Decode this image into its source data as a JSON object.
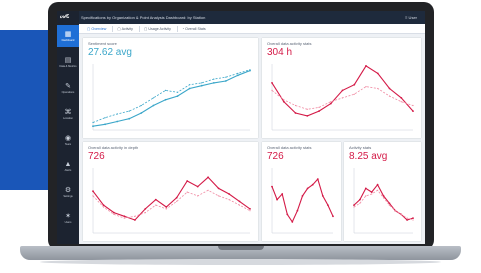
{
  "colors": {
    "accent": "#1f6fd6",
    "teal": "#3aa6c9",
    "crimson": "#d41a47",
    "pink_dashed": "#f08aa2",
    "sidebar": "#1c2330",
    "header": "#1e2a3c",
    "band": "#1a56b8"
  },
  "app": {
    "logo": "ᔕ∕∕Ɛ",
    "header_title": "Specifications by Organization & Point Analysis Dashboard: by Station",
    "header_user": "≡ User"
  },
  "sidebar": {
    "items": [
      {
        "label": "Dashboard",
        "icon": "dashboard-icon",
        "glyph": "▦",
        "active": true
      },
      {
        "label": "Data & Metrics",
        "icon": "data-icon",
        "glyph": "▤",
        "active": false
      },
      {
        "label": "Operations",
        "icon": "wrench-icon",
        "glyph": "✎",
        "active": false
      },
      {
        "label": "Location",
        "icon": "network-icon",
        "glyph": "⌘",
        "active": false
      },
      {
        "label": "Team",
        "icon": "globe-icon",
        "glyph": "◉",
        "active": false
      },
      {
        "label": "Alerts",
        "icon": "warning-icon",
        "glyph": "▲",
        "active": false
      },
      {
        "label": "Settings",
        "icon": "settings-icon",
        "glyph": "⚙",
        "active": false
      },
      {
        "label": "Users",
        "icon": "user-icon",
        "glyph": "✶",
        "active": false
      }
    ]
  },
  "tabs": [
    {
      "label": "▢ Overview",
      "active": true
    },
    {
      "label": "▢ Activity",
      "active": false
    },
    {
      "label": "▢ Usage Activity",
      "active": false
    },
    {
      "label": "◔ Overall Stats",
      "active": false
    }
  ],
  "cards": {
    "c1": {
      "title": "Sentiment score",
      "value": "27.62 avg"
    },
    "c2": {
      "title": "Overall data activity stats",
      "value": "304 h"
    },
    "c3": {
      "title": "Overall data activity in depth",
      "value": "726"
    },
    "c4": {
      "title": "Overall data activity stats",
      "value": "726"
    },
    "c5": {
      "title": "Activity stats",
      "value": "8.25 avg"
    }
  },
  "chart_data": [
    {
      "type": "line",
      "series": [
        {
          "values": [
            4,
            6,
            9,
            12,
            18,
            26,
            32,
            36,
            44,
            47,
            50,
            52,
            58,
            63
          ],
          "color": "#3aa6c9"
        },
        {
          "values": [
            8,
            13,
            17,
            20,
            26,
            34,
            42,
            40,
            48,
            50,
            54,
            56,
            60,
            64
          ],
          "color": "#3aa6c9",
          "dashed": true
        }
      ],
      "ylim": [
        0,
        70
      ]
    },
    {
      "type": "line",
      "series": [
        {
          "values": [
            50,
            30,
            18,
            15,
            20,
            28,
            42,
            48,
            68,
            60,
            44,
            34,
            20
          ],
          "color": "#d41a47"
        },
        {
          "values": [
            42,
            32,
            26,
            22,
            24,
            30,
            34,
            38,
            46,
            44,
            36,
            30,
            26
          ],
          "color": "#f08aa2",
          "dashed": true
        }
      ],
      "ylim": [
        0,
        70
      ]
    },
    {
      "type": "line",
      "series": [
        {
          "values": [
            45,
            30,
            22,
            18,
            14,
            26,
            36,
            28,
            38,
            56,
            50,
            60,
            48,
            42,
            34,
            26
          ],
          "color": "#d41a47"
        },
        {
          "values": [
            40,
            28,
            20,
            16,
            18,
            22,
            30,
            26,
            34,
            44,
            40,
            46,
            40,
            36,
            30,
            24
          ],
          "color": "#f08aa2",
          "dashed": true
        }
      ],
      "ylim": [
        0,
        70
      ]
    },
    {
      "type": "line",
      "series": [
        {
          "values": [
            50,
            36,
            42,
            20,
            12,
            24,
            40,
            48,
            52,
            58,
            40,
            30,
            18
          ],
          "color": "#d41a47"
        }
      ],
      "ylim": [
        0,
        70
      ]
    },
    {
      "type": "line",
      "series": [
        {
          "values": [
            30,
            36,
            48,
            44,
            52,
            40,
            32,
            24,
            20,
            14,
            16
          ],
          "color": "#d41a47"
        },
        {
          "values": [
            28,
            32,
            40,
            42,
            46,
            38,
            30,
            24,
            20,
            16,
            14
          ],
          "color": "#f08aa2",
          "dashed": true
        }
      ],
      "ylim": [
        0,
        70
      ]
    }
  ]
}
